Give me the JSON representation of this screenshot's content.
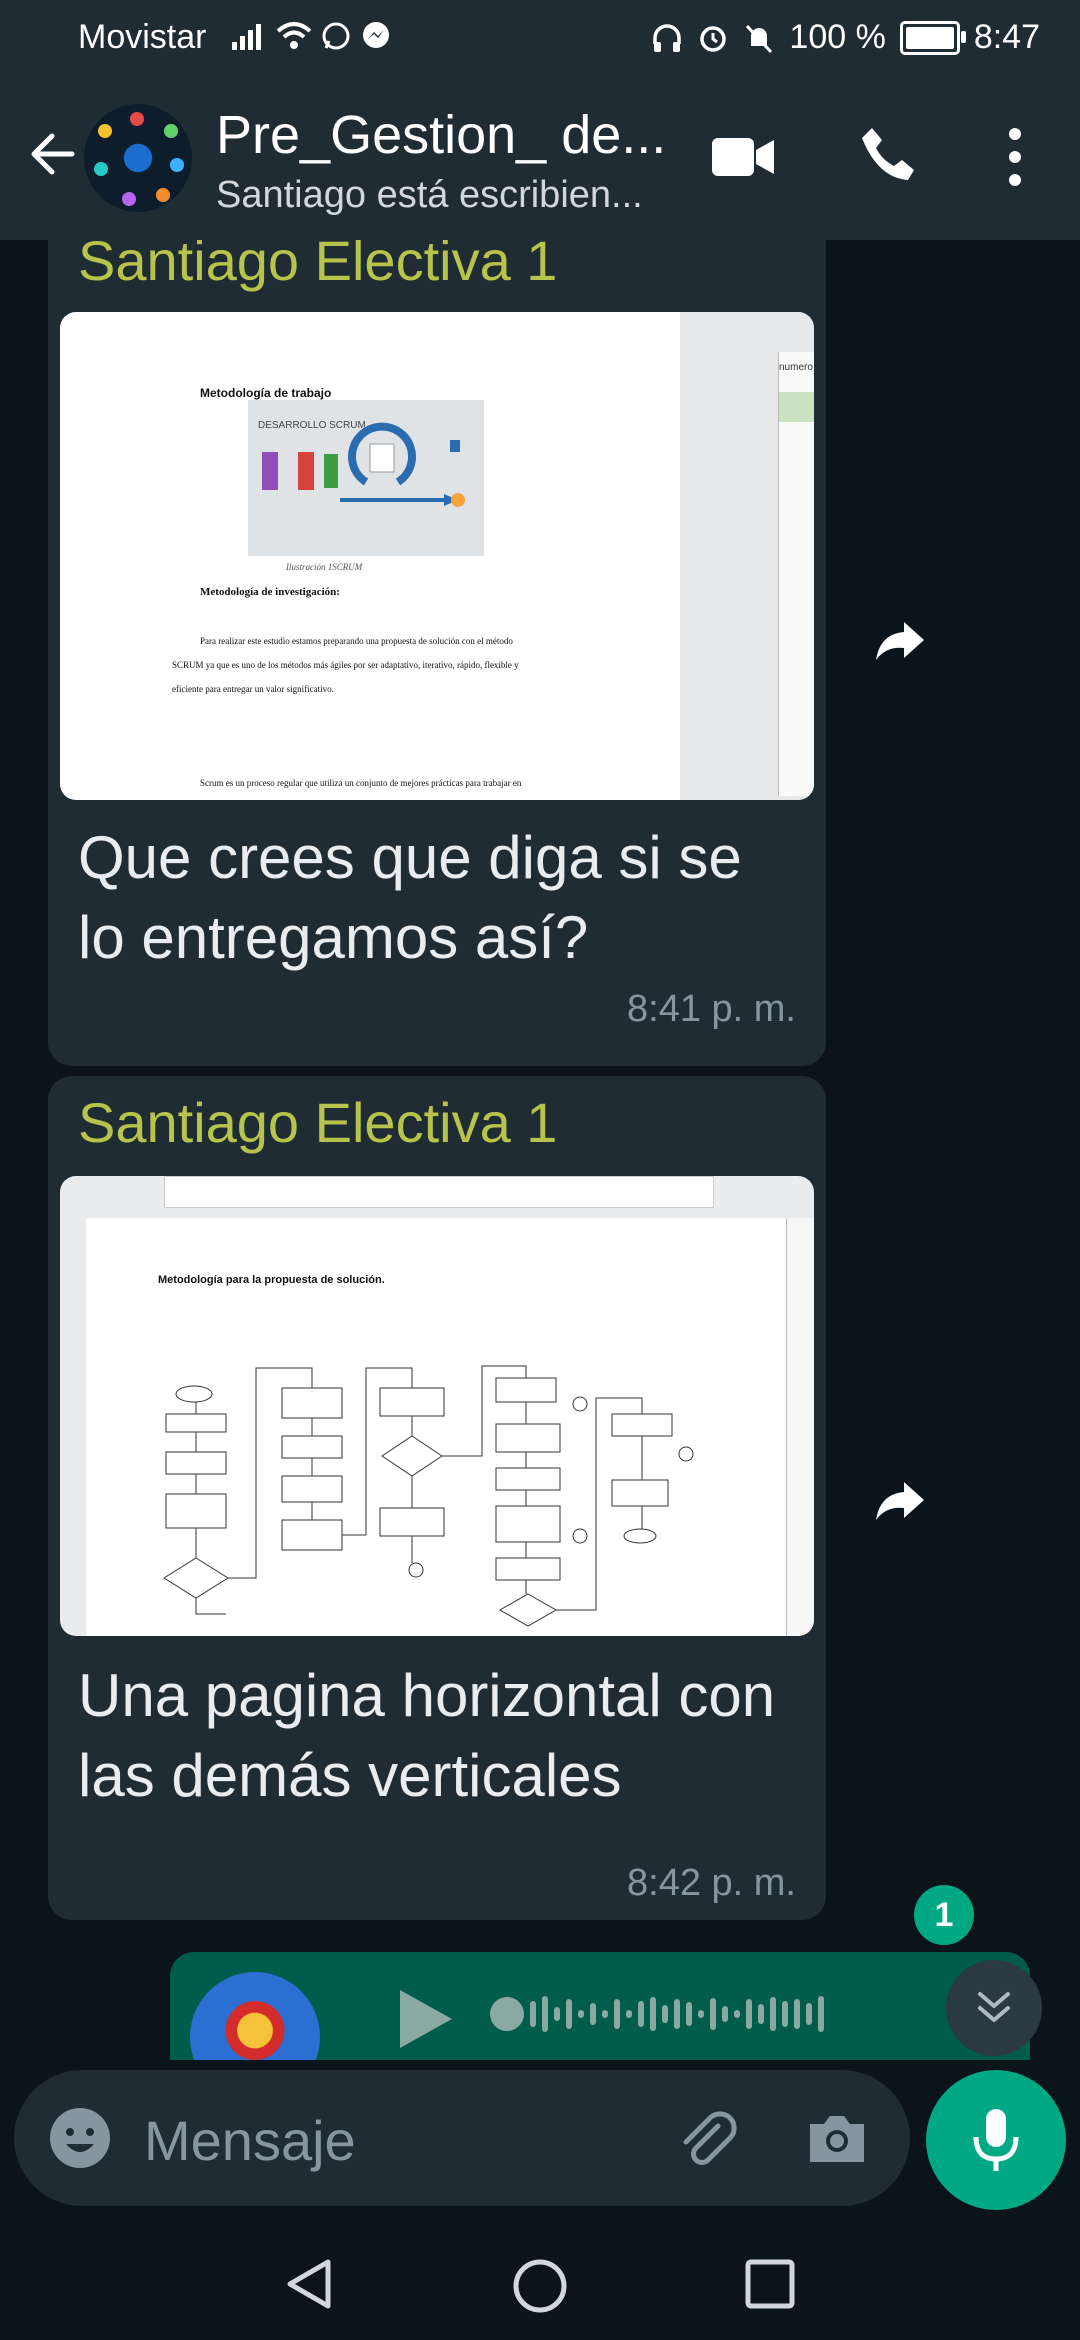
{
  "status_bar": {
    "carrier": "Movistar",
    "battery": "100 %",
    "time": "8:47"
  },
  "header": {
    "title": "Pre_Gestion_ de...",
    "subtitle": "Santiago está escribien..."
  },
  "messages": [
    {
      "sender": "Santiago Electiva 1",
      "image": {
        "heading": "Metodología de trabajo",
        "figure_label": "DESARROLLO SCRUM",
        "caption": "Ilustración 1SCRUM",
        "section": "Metodología de investigación:",
        "line1": "Para realizar este estudio estamos preparando una propuesta de solución con el método",
        "line2": "SCRUM ya que es uno de los métodos más ágiles por ser adaptativo, iterativo, rápido, flexible y",
        "line3": "eficiente para entregar un valor significativo.",
        "line4": "Scrum es un proceso regular que utiliza un conjunto de mejores prácticas para trabajar en",
        "side_text": "numero"
      },
      "text": "Que crees que diga si se lo entregamos así?",
      "time": "8:41 p. m."
    },
    {
      "sender": "Santiago Electiva 1",
      "image": {
        "heading": "Metodología para la propuesta de solución."
      },
      "text": "Una pagina horizontal con las demás verticales",
      "time": "8:42 p. m."
    }
  ],
  "unread_badge": "1",
  "composer": {
    "placeholder": "Mensaje"
  },
  "icons": {
    "back": "arrow-left-icon",
    "video": "video-call-icon",
    "call": "phone-icon",
    "more": "more-vert-icon",
    "forward": "forward-icon",
    "emoji": "emoji-icon",
    "attach": "paperclip-icon",
    "camera": "camera-icon",
    "mic": "mic-icon"
  },
  "colors": {
    "background": "#0b141a",
    "bar": "#1f2c34",
    "incoming_bubble": "#202c33",
    "outgoing_bubble": "#005c4b",
    "accent": "#00a884",
    "sender_name": "#b7c34a"
  }
}
